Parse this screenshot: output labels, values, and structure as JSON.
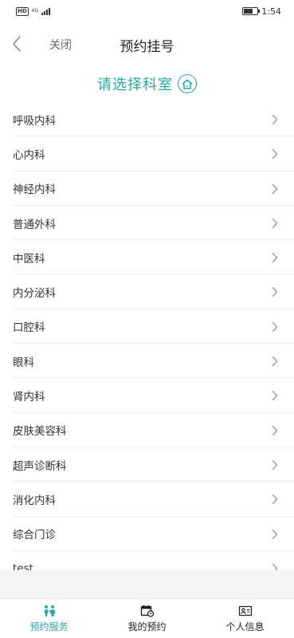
{
  "status_bar": {
    "hd": "HD",
    "network": "4G",
    "time": "1:54",
    "battery_level": 0.7
  },
  "header": {
    "back_icon": "chevron-left-icon",
    "close_label": "关闭",
    "title": "预约挂号"
  },
  "section": {
    "title": "请选择科室",
    "icon": "house-icon"
  },
  "departments": [
    "呼吸内科",
    "心内科",
    "神经内科",
    "普通外科",
    "中医科",
    "内分泌科",
    "口腔科",
    "眼科",
    "肾内科",
    "皮肤美容科",
    "超声诊断科",
    "消化内科",
    "综合门诊",
    "test"
  ],
  "tabs": [
    {
      "label": "预约服务",
      "icon": "people-icon",
      "active": true
    },
    {
      "label": "我的预约",
      "icon": "calendar-clock-icon",
      "active": false
    },
    {
      "label": "个人信息",
      "icon": "profile-card-icon",
      "active": false
    }
  ],
  "colors": {
    "accent": "#26a8a4",
    "text": "#333333",
    "divider": "#eeeeee",
    "footer_gray": "#f5f5f5"
  }
}
